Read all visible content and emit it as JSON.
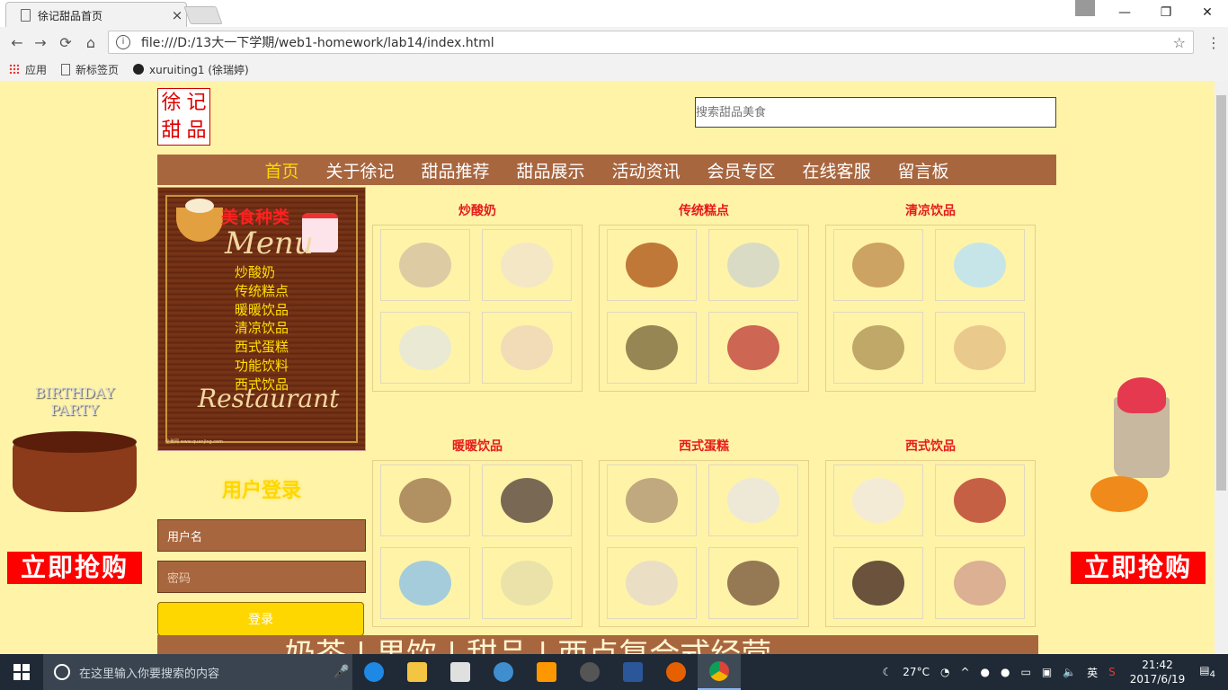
{
  "browser": {
    "tab_title": "徐记甜品首页",
    "tab_close": "×",
    "url": "file:///D:/13大一下学期/web1-homework/lab14/index.html",
    "info_icon": "i",
    "star": "☆",
    "menu_dots": "⋮",
    "window_min": "—",
    "window_max": "❐",
    "window_close": "✕",
    "nav_back": "←",
    "nav_forward": "→",
    "nav_reload": "⟳",
    "nav_home": "⌂",
    "bookmarks": [
      {
        "label": "应用",
        "icon": "apps-icon"
      },
      {
        "label": "新标签页",
        "icon": "page-icon"
      },
      {
        "label": "xuruiting1 (徐瑞婷)",
        "icon": "github-icon"
      }
    ]
  },
  "site": {
    "logo_chars": [
      "徐",
      "记",
      "甜",
      "品"
    ],
    "search_placeholder": "搜索甜品美食",
    "nav": [
      {
        "label": "首页",
        "active": true
      },
      {
        "label": "关于徐记",
        "active": false
      },
      {
        "label": "甜品推荐",
        "active": false
      },
      {
        "label": "甜品展示",
        "active": false
      },
      {
        "label": "活动资讯",
        "active": false
      },
      {
        "label": "会员专区",
        "active": false
      },
      {
        "label": "在线客服",
        "active": false
      },
      {
        "label": "留言板",
        "active": false
      }
    ],
    "menu_board": {
      "title": "美食种类",
      "script_top": "Menu",
      "script_bottom": "Restaurant",
      "footer": "全景网 www.quanjing.com",
      "items": [
        "炒酸奶",
        "传统糕点",
        "暖暖饮品",
        "清凉饮品",
        "西式蛋糕",
        "功能饮料",
        "西式饮品"
      ]
    },
    "login": {
      "title": "用户登录",
      "username_placeholder": "用户名",
      "password_placeholder": "密码",
      "submit_label": "登录"
    },
    "categories": [
      {
        "title": "炒酸奶",
        "colors": [
          "#d9c7a3",
          "#f2e6c8",
          "#e7e8d8",
          "#f0d9b8"
        ]
      },
      {
        "title": "传统糕点",
        "colors": [
          "#b86a2a",
          "#d6d8c8",
          "#8a7a4a",
          "#c9564a"
        ]
      },
      {
        "title": "清凉饮品",
        "colors": [
          "#c79a5a",
          "#bfe3ee",
          "#b8a060",
          "#e8c48a"
        ]
      },
      {
        "title": "暖暖饮品",
        "colors": [
          "#a8865a",
          "#6a5a4a",
          "#9ac8e0",
          "#e8e0a8"
        ]
      },
      {
        "title": "西式蛋糕",
        "colors": [
          "#b9a07a",
          "#ece8dc",
          "#e8ddc8",
          "#8a6a4a"
        ]
      },
      {
        "title": "西式饮品",
        "colors": [
          "#f3eadc",
          "#c0503a",
          "#5a4030",
          "#d8a890"
        ]
      }
    ],
    "side_ads": {
      "left_label": "立即抢购",
      "left_caption": "BIRTHDAY PARTY",
      "right_label": "立即抢购"
    },
    "bottom_slogan": "奶茶 | 果饮 | 甜品 | 西点复合式经营"
  },
  "taskbar": {
    "search_placeholder": "在这里输入你要搜索的内容",
    "weather": "27°C",
    "ime": "英",
    "time": "21:42",
    "date": "2017/6/19",
    "notifications": "4"
  }
}
